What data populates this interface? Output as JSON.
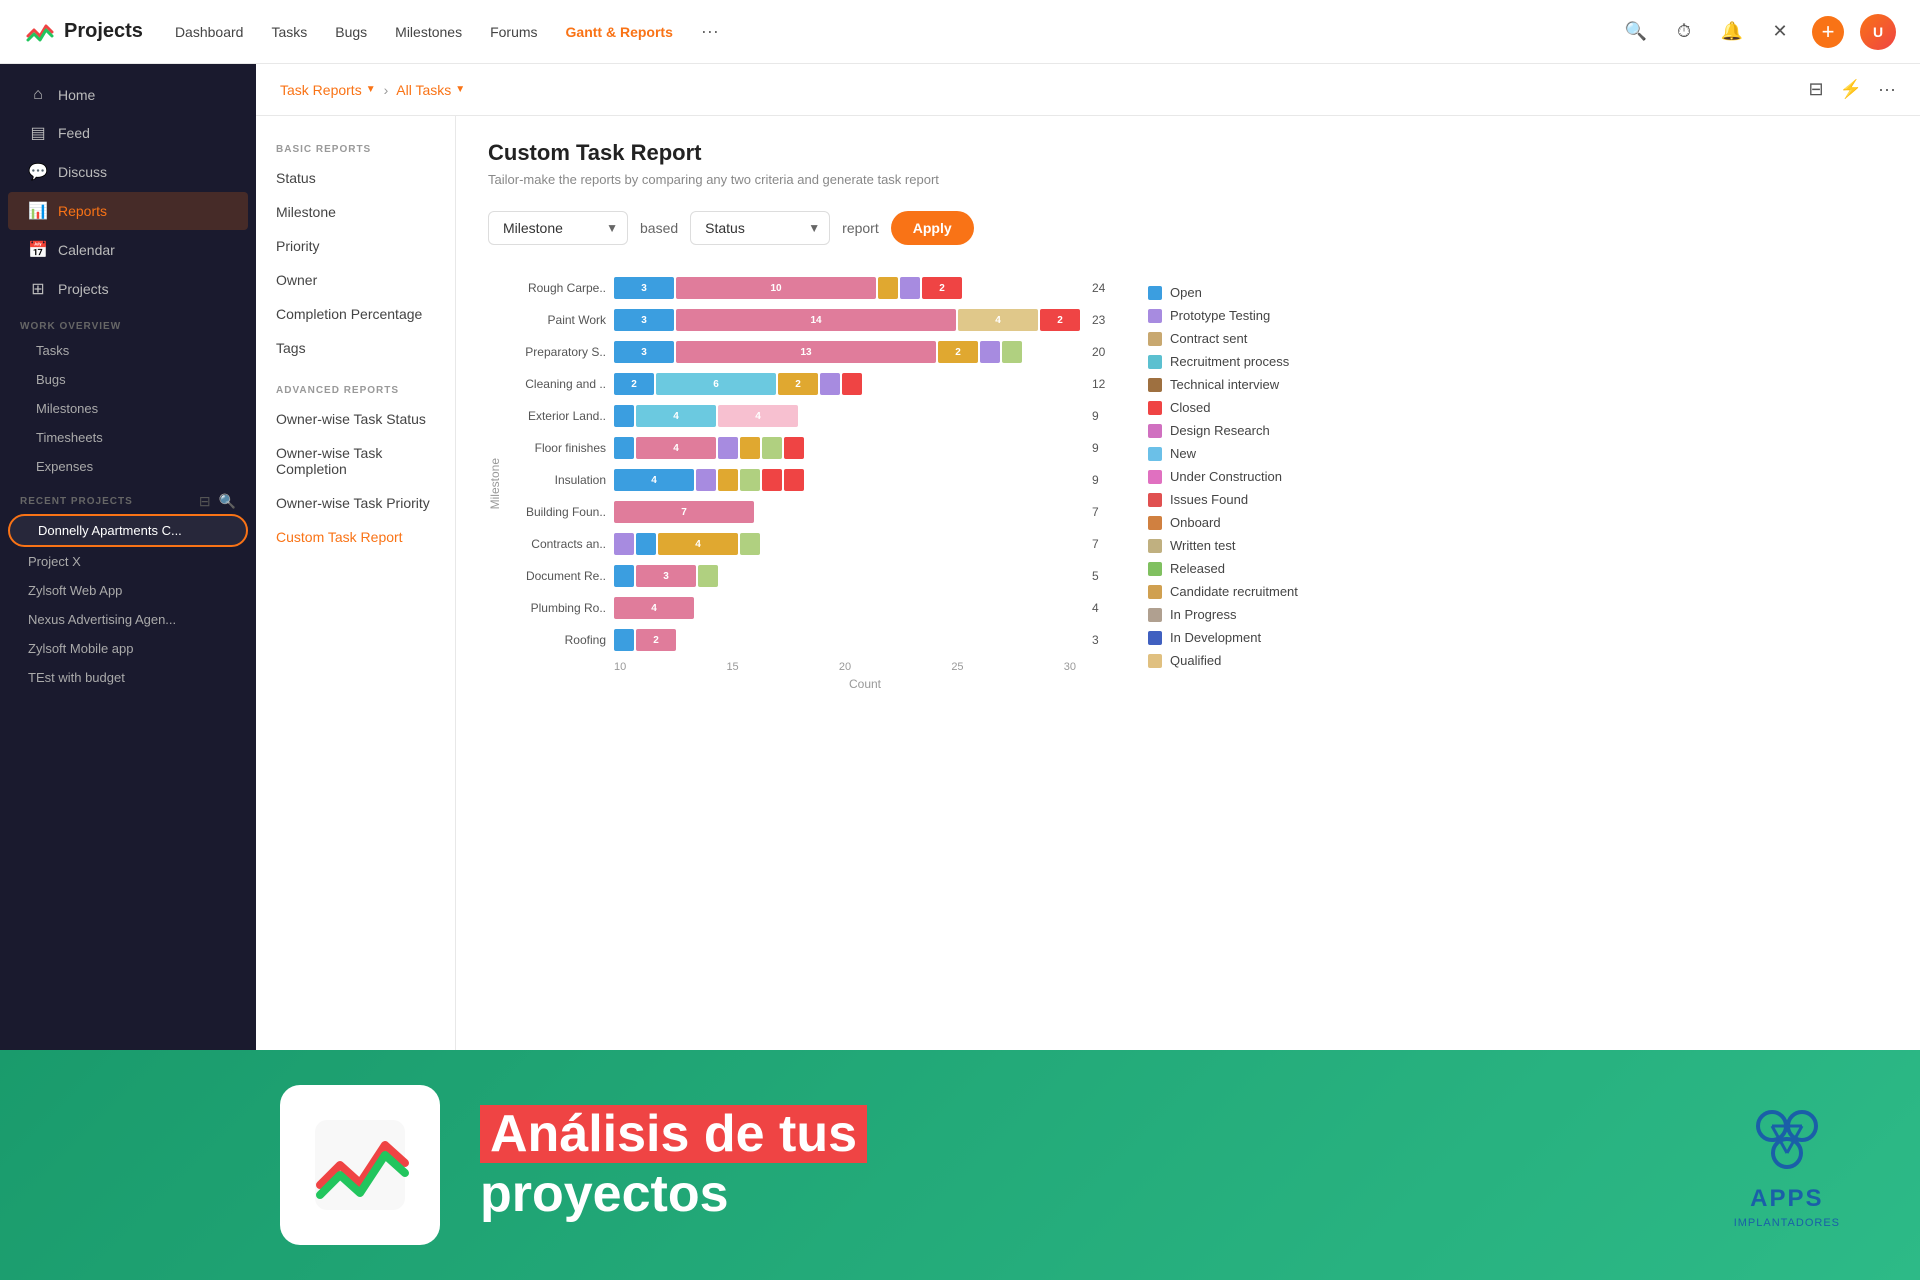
{
  "brand": {
    "name": "Projects",
    "hamburger": "≡"
  },
  "topnav": {
    "links": [
      {
        "label": "Dashboard",
        "active": false
      },
      {
        "label": "Tasks",
        "active": false
      },
      {
        "label": "Bugs",
        "active": false
      },
      {
        "label": "Milestones",
        "active": false
      },
      {
        "label": "Forums",
        "active": false
      },
      {
        "label": "Gantt & Reports",
        "active": true
      },
      {
        "label": "...",
        "active": false
      }
    ]
  },
  "sidebar": {
    "main_items": [
      {
        "label": "Home",
        "icon": "⌂"
      },
      {
        "label": "Feed",
        "icon": "⊟"
      },
      {
        "label": "Discuss",
        "icon": "💬"
      },
      {
        "label": "Reports",
        "icon": "📊",
        "active": true
      },
      {
        "label": "Calendar",
        "icon": "📅"
      },
      {
        "label": "Projects",
        "icon": "⊞"
      }
    ],
    "work_overview_label": "WORK OVERVIEW",
    "work_items": [
      "Tasks",
      "Bugs",
      "Milestones",
      "Timesheets",
      "Expenses"
    ],
    "recent_label": "RECENT PROJECTS",
    "recent_projects": [
      {
        "label": "Donnelly Apartments C...",
        "highlighted": true
      },
      {
        "label": "Project X"
      },
      {
        "label": "Zylsoft Web App"
      },
      {
        "label": "Nexus Advertising Agen..."
      },
      {
        "label": "Zylsoft Mobile app"
      },
      {
        "label": "TEst with budget"
      }
    ]
  },
  "breadcrumb": {
    "parent": "Task Reports",
    "current": "All Tasks"
  },
  "reports_sidebar": {
    "basic_label": "BASIC REPORTS",
    "basic_items": [
      "Status",
      "Milestone",
      "Priority",
      "Owner",
      "Completion Percentage",
      "Tags"
    ],
    "advanced_label": "ADVANCED REPORTS",
    "advanced_items": [
      "Owner-wise Task Status",
      "Owner-wise Task Completion",
      "Owner-wise Task Priority",
      "Custom Task Report"
    ]
  },
  "report": {
    "title": "Custom Task Report",
    "subtitle": "Tailor-make the reports by comparing any two criteria and generate task report",
    "criterion1": "Milestone",
    "based_text": "based",
    "criterion2": "Status",
    "report_text": "report",
    "apply_btn": "Apply"
  },
  "chart": {
    "y_label": "Milestone",
    "x_label": "Count",
    "x_ticks": [
      "10",
      "15",
      "20",
      "25",
      "30"
    ],
    "rows": [
      {
        "label": "Rough Carpe..",
        "segments": [
          {
            "color": "#3b9ee0",
            "val": 3
          },
          {
            "color": "#e07c9b",
            "val": 10
          },
          {
            "color": "#e0a830",
            "val": 1
          },
          {
            "color": "#a78be0",
            "val": 1
          },
          {
            "color": "#ef4444",
            "val": 2
          }
        ],
        "total": 24
      },
      {
        "label": "Paint Work",
        "segments": [
          {
            "color": "#3b9ee0",
            "val": 3
          },
          {
            "color": "#e07c9b",
            "val": 14
          },
          {
            "color": "#e0c88a",
            "val": 4
          },
          {
            "color": "#ef4444",
            "val": 2
          }
        ],
        "total": 23
      },
      {
        "label": "Preparatory S..",
        "segments": [
          {
            "color": "#3b9ee0",
            "val": 3
          },
          {
            "color": "#e07c9b",
            "val": 13
          },
          {
            "color": "#e0a830",
            "val": 2
          },
          {
            "color": "#a78be0",
            "val": 1
          },
          {
            "color": "#b0d080",
            "val": 1
          }
        ],
        "total": 20
      },
      {
        "label": "Cleaning and ..",
        "segments": [
          {
            "color": "#3b9ee0",
            "val": 2
          },
          {
            "color": "#6bc9e0",
            "val": 6
          },
          {
            "color": "#e0a830",
            "val": 2
          },
          {
            "color": "#a78be0",
            "val": 1
          },
          {
            "color": "#ef4444",
            "val": 1
          }
        ],
        "total": 12
      },
      {
        "label": "Exterior Land..",
        "segments": [
          {
            "color": "#3b9ee0",
            "val": 1
          },
          {
            "color": "#6bc9e0",
            "val": 4
          },
          {
            "color": "#f7c0d0",
            "val": 4
          }
        ],
        "total": 9
      },
      {
        "label": "Floor finishes",
        "segments": [
          {
            "color": "#3b9ee0",
            "val": 1
          },
          {
            "color": "#e07c9b",
            "val": 4
          },
          {
            "color": "#a78be0",
            "val": 1
          },
          {
            "color": "#e0a830",
            "val": 1
          },
          {
            "color": "#b0d080",
            "val": 1
          },
          {
            "color": "#ef4444",
            "val": 1
          }
        ],
        "total": 9
      },
      {
        "label": "Insulation",
        "segments": [
          {
            "color": "#3b9ee0",
            "val": 4
          },
          {
            "color": "#a78be0",
            "val": 1
          },
          {
            "color": "#e0a830",
            "val": 1
          },
          {
            "color": "#b0d080",
            "val": 1
          },
          {
            "color": "#ef4444",
            "val": 1
          },
          {
            "color": "#ef4444",
            "val": 1
          }
        ],
        "total": 9
      },
      {
        "label": "Building Foun..",
        "segments": [
          {
            "color": "#e07c9b",
            "val": 7
          }
        ],
        "total": 7
      },
      {
        "label": "Contracts an..",
        "segments": [
          {
            "color": "#a78be0",
            "val": 1
          },
          {
            "color": "#3b9ee0",
            "val": 1
          },
          {
            "color": "#e0a830",
            "val": 4
          },
          {
            "color": "#b0d080",
            "val": 1
          }
        ],
        "total": 7
      },
      {
        "label": "Document Re..",
        "segments": [
          {
            "color": "#3b9ee0",
            "val": 1
          },
          {
            "color": "#e07c9b",
            "val": 3
          },
          {
            "color": "#b0d080",
            "val": 1
          }
        ],
        "total": 5
      },
      {
        "label": "Plumbing Ro..",
        "segments": [
          {
            "color": "#e07c9b",
            "val": 4
          }
        ],
        "total": 4
      },
      {
        "label": "Roofing",
        "segments": [
          {
            "color": "#3b9ee0",
            "val": 1
          },
          {
            "color": "#e07c9b",
            "val": 2
          }
        ],
        "total": 3
      }
    ]
  },
  "legend": {
    "items": [
      {
        "label": "Open",
        "color": "#3b9ee0"
      },
      {
        "label": "Prototype Testing",
        "color": "#a78be0"
      },
      {
        "label": "Contract sent",
        "color": "#c8a870"
      },
      {
        "label": "Recruitment process",
        "color": "#5bc0d0"
      },
      {
        "label": "Technical interview",
        "color": "#9e7040"
      },
      {
        "label": "Closed",
        "color": "#ef4444"
      },
      {
        "label": "Design Research",
        "color": "#d070c0"
      },
      {
        "label": "New",
        "color": "#6bc0e8"
      },
      {
        "label": "Under Construction",
        "color": "#e070c0"
      },
      {
        "label": "Issues Found",
        "color": "#e05050"
      },
      {
        "label": "Onboard",
        "color": "#d08040"
      },
      {
        "label": "Written test",
        "color": "#c0b080"
      },
      {
        "label": "Released",
        "color": "#80c060"
      },
      {
        "label": "Candidate recruitment",
        "color": "#d0a050"
      },
      {
        "label": "In Progress",
        "color": "#b0a090"
      },
      {
        "label": "In Development",
        "color": "#4060c0"
      },
      {
        "label": "Qualified",
        "color": "#e0c080"
      }
    ]
  },
  "overlay": {
    "text_line1": "Análisis de tus",
    "text_line2": "proyectos"
  },
  "apps": {
    "name": "APPS",
    "sub": "IMPLANTADORES"
  }
}
